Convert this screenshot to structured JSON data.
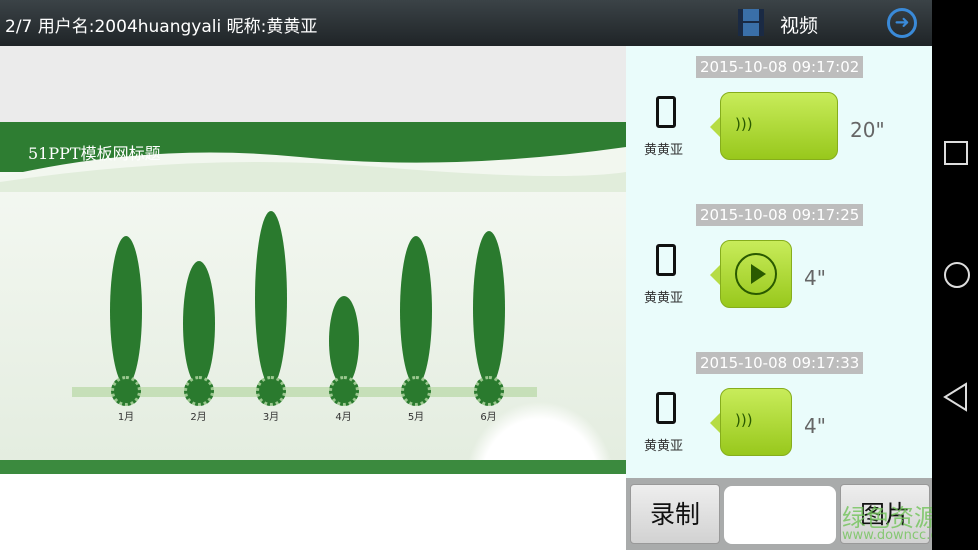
{
  "header": {
    "title": "2/7 用户名:2004huangyali   昵称:黄黄亚",
    "video_label": "视频"
  },
  "slide": {
    "title": "51PPT模板网标题",
    "months": [
      "1月",
      "2月",
      "3月",
      "4月",
      "5月",
      "6月"
    ],
    "leaf_heights": [
      150,
      125,
      175,
      90,
      150,
      155
    ]
  },
  "messages": [
    {
      "timestamp": "2015-10-08 09:17:02",
      "sender": "黄黄亚",
      "duration": "20\"",
      "state": "sound"
    },
    {
      "timestamp": "2015-10-08 09:17:25",
      "sender": "黄黄亚",
      "duration": "4\"",
      "state": "play"
    },
    {
      "timestamp": "2015-10-08 09:17:33",
      "sender": "黄黄亚",
      "duration": "4\"",
      "state": "sound"
    }
  ],
  "bottom": {
    "record_label": "录制",
    "image_label": "图片",
    "input_value": ""
  },
  "watermark": {
    "name": "绿色资源网",
    "url": "www.downcc.com"
  }
}
